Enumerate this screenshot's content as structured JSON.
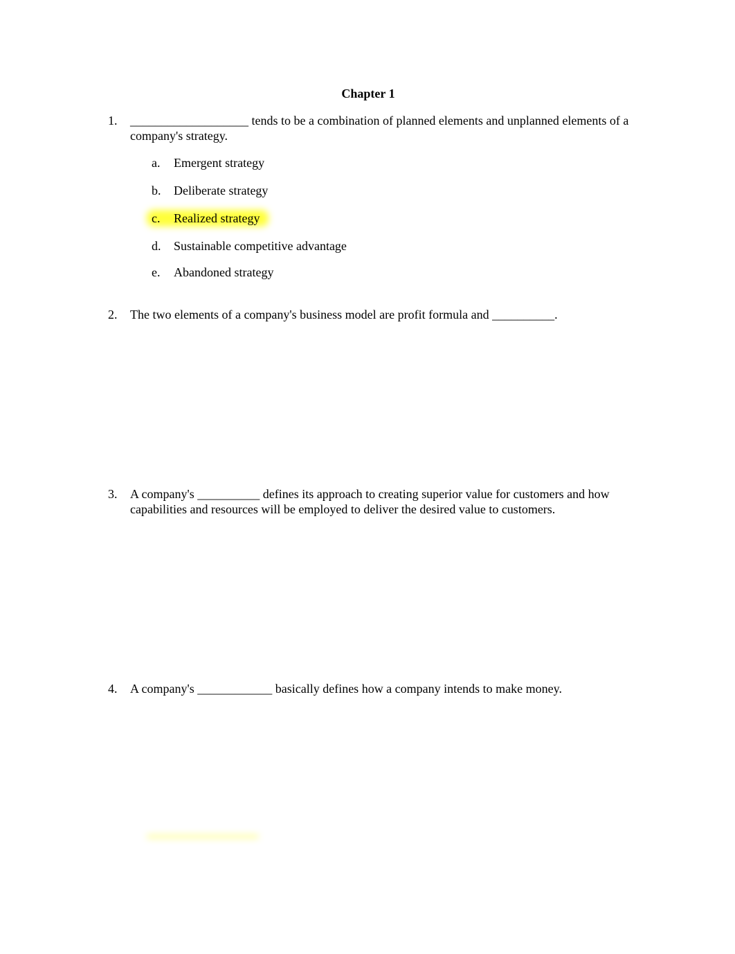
{
  "document": {
    "title": "Chapter 1",
    "questions": [
      {
        "number": "1.",
        "text": "___________________ tends to be a combination of planned elements and unplanned elements of a company's strategy.",
        "options": [
          {
            "letter": "a.",
            "label": "Emergent strategy",
            "highlighted": false
          },
          {
            "letter": "b.",
            "label": "Deliberate strategy",
            "highlighted": false
          },
          {
            "letter": "c.",
            "label": "Realized strategy",
            "highlighted": true
          },
          {
            "letter": "d.",
            "label": "Sustainable competitive advantage",
            "highlighted": false
          },
          {
            "letter": "e.",
            "label": "Abandoned strategy",
            "highlighted": false
          }
        ]
      },
      {
        "number": "2.",
        "text": "The two elements of a company's business model are profit formula and __________."
      },
      {
        "number": "3.",
        "text": "A company's __________ defines its approach to creating superior value for customers and how capabilities and resources will be employed to deliver the desired value to customers."
      },
      {
        "number": "4.",
        "text": "A company's ____________ basically defines how a company intends to make money."
      }
    ],
    "highlight_color": "#ffff3a"
  }
}
